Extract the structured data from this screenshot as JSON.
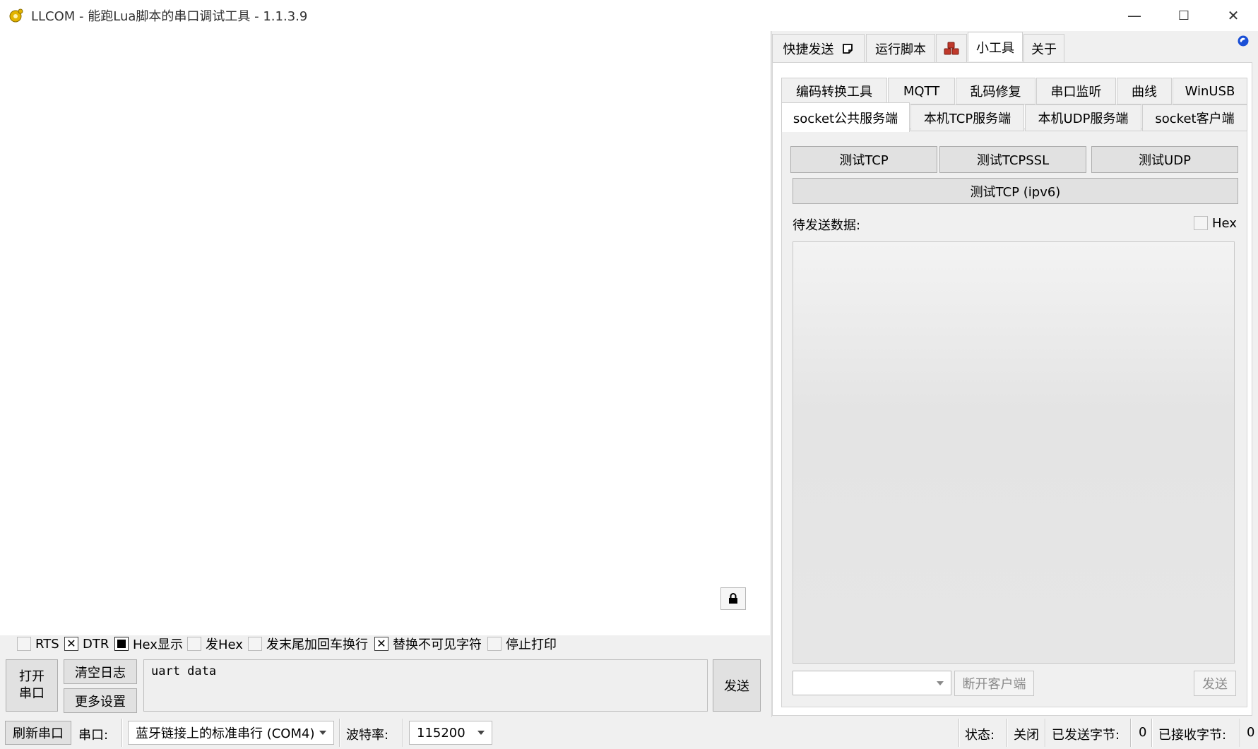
{
  "window": {
    "title": "LLCOM - 能跑Lua脚本的串口调试工具 - 1.1.3.9",
    "controls": {
      "minimize": "—",
      "maximize": "☐",
      "close": "✕"
    }
  },
  "log": {
    "lock_icon": "lock-icon"
  },
  "options": {
    "rts": {
      "label": "RTS",
      "checked": false
    },
    "dtr": {
      "label": "DTR",
      "checked": true
    },
    "hex_show": {
      "label": "Hex显示",
      "checked": true
    },
    "send_hex": {
      "label": "发Hex",
      "checked": false
    },
    "append_crlf": {
      "label": "发末尾加回车换行",
      "checked": false
    },
    "replace_invisible": {
      "label": "替换不可见字符",
      "checked": true
    },
    "stop_print": {
      "label": "停止打印",
      "checked": false
    }
  },
  "actions": {
    "open_port_line1": "打开",
    "open_port_line2": "串口",
    "clear_log": "清空日志",
    "more_settings": "更多设置",
    "send_input_value": "uart data",
    "send": "发送"
  },
  "statusbar": {
    "refresh_port": "刷新串口",
    "port_label": "串口:",
    "port_value": "蓝牙链接上的标准串行 (COM4)",
    "baud_label": "波特率:",
    "baud_value": "115200",
    "state_label": "状态:",
    "state_value": "关闭",
    "sent_label": "已发送字节:",
    "sent_value": "0",
    "recv_label": "已接收字节:",
    "recv_value": "0"
  },
  "top_tabs": [
    {
      "label": "快捷发送"
    },
    {
      "label": "运行脚本"
    },
    {
      "label": ""
    },
    {
      "label": "小工具"
    },
    {
      "label": "关于"
    }
  ],
  "sub_tabs_row1": [
    {
      "label": "编码转换工具"
    },
    {
      "label": "MQTT"
    },
    {
      "label": "乱码修复"
    },
    {
      "label": "串口监听"
    },
    {
      "label": "曲线"
    },
    {
      "label": "WinUSB"
    }
  ],
  "sub_tabs_row2": [
    {
      "label": "socket公共服务端"
    },
    {
      "label": "本机TCP服务端"
    },
    {
      "label": "本机UDP服务端"
    },
    {
      "label": "socket客户端"
    }
  ],
  "socket": {
    "test_tcp": "测试TCP",
    "test_tcpssl": "测试TCPSSL",
    "test_udp": "测试UDP",
    "test_tcp_ipv6": "测试TCP (ipv6)",
    "pending_label": "待发送数据:",
    "hex_label": "Hex",
    "client_select_value": "",
    "disconnect": "断开客户端",
    "send": "发送"
  },
  "colors": {
    "accent": "#0078d7",
    "window_bg": "#f0f0f0",
    "button_bg": "#e1e1e1"
  }
}
